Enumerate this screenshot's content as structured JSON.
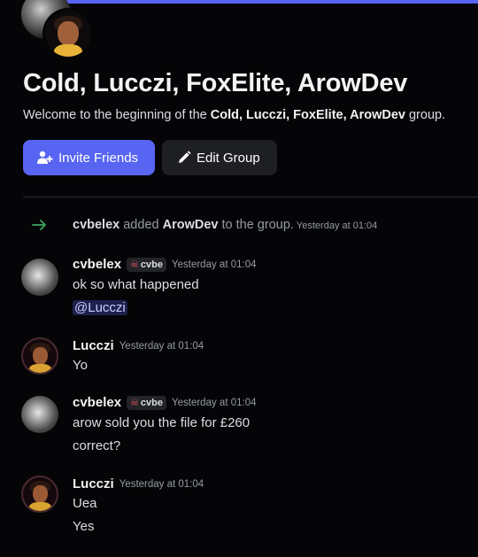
{
  "header": {
    "title": "Cold, Lucczi, FoxElite, ArowDev",
    "welcome_prefix": "Welcome to the beginning of the ",
    "welcome_group": "Cold, Lucczi, FoxElite, ArowDev",
    "welcome_suffix": " group."
  },
  "actions": {
    "invite_label": "Invite Friends",
    "edit_label": "Edit Group"
  },
  "system_message": {
    "actor": "cvbelex",
    "verb": " added ",
    "target": "ArowDev",
    "suffix": " to the group.",
    "timestamp": "Yesterday at 01:04",
    "icon": "arrow-right-icon",
    "color": "#3ba55c"
  },
  "messages": [
    {
      "author": "cvbelex",
      "tag": "cvbe",
      "timestamp": "Yesterday at 01:04",
      "lines": [
        "ok so what happened"
      ],
      "mention": "@Lucczi"
    },
    {
      "author": "Lucczi",
      "timestamp": "Yesterday at 01:04",
      "lines": [
        "Yo"
      ]
    },
    {
      "author": "cvbelex",
      "tag": "cvbe",
      "timestamp": "Yesterday at 01:04",
      "lines": [
        "arow sold you the file for £260",
        "correct?"
      ]
    },
    {
      "author": "Lucczi",
      "timestamp": "Yesterday at 01:04",
      "lines": [
        "Uea",
        "Yes"
      ]
    }
  ],
  "colors": {
    "accent": "#5865f2",
    "background": "#050507"
  }
}
